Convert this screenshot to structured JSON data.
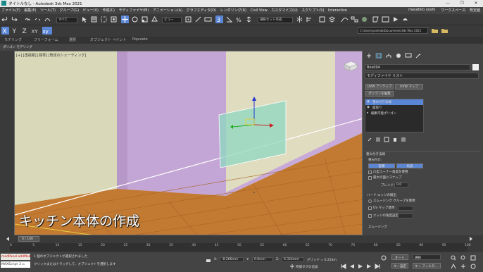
{
  "window": {
    "title": "タイトルなし - Autodesk 3ds Max 2021",
    "controls": [
      "—",
      "❐",
      "✕"
    ]
  },
  "menubar": {
    "items": [
      "ファイル(F)",
      "編集(E)",
      "ツール(T)",
      "グループ(G)",
      "ビュー(V)",
      "作成(C)",
      "モディファイヤ(M)",
      "アニメーション(A)",
      "グラフエディタ(D)",
      "レンダリング(R)",
      "Civil View",
      "カスタマイズ(U)",
      "スクリプト(S)",
      "Interactive"
    ],
    "user": "masahiro yoshi",
    "workspaces_label": "ワークスペース:",
    "workspace_value": "既定値"
  },
  "toolbar": {
    "all_dropdown": "すべて",
    "view_dropdown": "ビュー",
    "selection_set": "選択セット作成"
  },
  "path": {
    "value": "C:\\Users\\yoshida\\Documents\\3ds Max 2021"
  },
  "ribbon": {
    "tabs": [
      "モデリング",
      "フリーフォーム",
      "選択",
      "オブジェクト ペイント",
      "Populate"
    ],
    "sub": "ポリゴン モデリング"
  },
  "viewport": {
    "label": "[+] [透視図] [標準] [既定のシェーディング]",
    "subtitle": "キッチン本体の作成"
  },
  "command_panel": {
    "object_name": "Box004",
    "modifier_list": "モディファイヤ リスト",
    "btn_uvw_unwrap": "UVW アンラップ",
    "btn_uvw_map": "UVW マップ",
    "btn_edit_poly": "ポリゴンを編集",
    "stack": [
      {
        "label": "重み付き法線",
        "selected": true
      },
      {
        "label": "面取り",
        "selected": false
      },
      {
        "label": "編集可能ポリゴン",
        "selected": false
      }
    ],
    "rollout_title": "重み付き法線",
    "weight_label": "重み付け:",
    "btn_area": "面積",
    "btn_angle": "角度",
    "check_angle": "凸型コーナー角度を使用",
    "check_snap": "最大の面にスナップ",
    "blend_label": "ブレンド:",
    "blend_value": "0.0",
    "hard_edge_title": "ハード エッジの検出",
    "smoothing_label": "スムージング グループを使用",
    "uv_label": "UV マップ境界:",
    "edge_label": "エッジの角度設定:",
    "bottom_label": "スムージング"
  },
  "timeline": {
    "frame": "0 / 100",
    "ticks": [
      "0",
      "5",
      "10",
      "15",
      "20",
      "25",
      "30",
      "35",
      "40",
      "45",
      "50",
      "55",
      "60",
      "65",
      "70",
      "75",
      "80",
      "85",
      "90",
      "95",
      "100"
    ]
  },
  "status": {
    "script_listener": "modPanel.addMod",
    "maxscript": "MAXScript ミニ",
    "line1": "1 個のオブジェクトが選択されました",
    "line2": "クリックまたはドラッグして、オブジェクトを選択します",
    "x_label": "X:",
    "x_val": "-8.266mm",
    "y_label": "Y:",
    "y_val": "0.0mm",
    "z_label": "Z:",
    "z_val": "6.324mm",
    "grid": "グリッド = 6.254m",
    "tag": "時間タグの追加",
    "auto": "オート",
    "selection_mode": "選択",
    "set_key": "キー設定",
    "filters": "キー フィルタ..."
  },
  "colors": {
    "viewport_bg": "#d9d9b9",
    "wall_purple": "#c8a8d8",
    "floor_wood": "#c07a30",
    "selection_box": "#8fd8c0",
    "highlight_blue": "#5b86d6"
  }
}
